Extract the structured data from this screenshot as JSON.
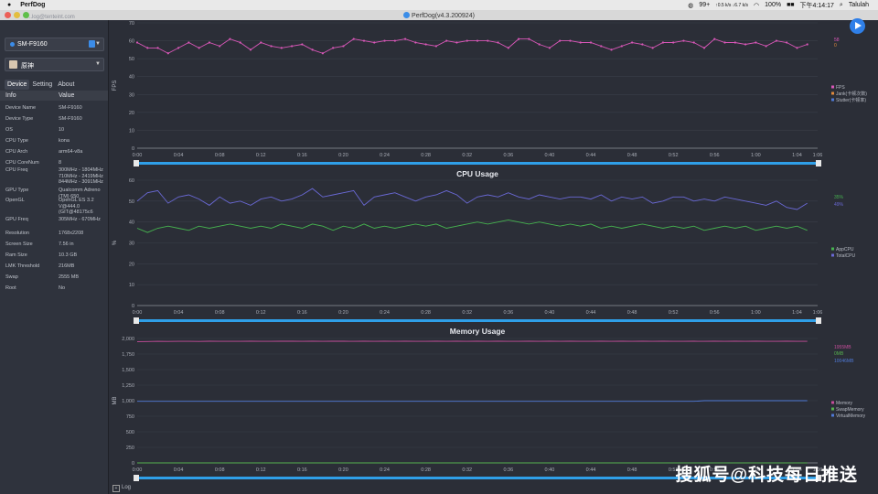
{
  "menubar": {
    "app": "PerfDog",
    "status_notifications": "99+",
    "net_speed": "↑0.5 k/s ↓6.7 k/s",
    "battery": "100%",
    "battery_badge": "■■",
    "clock": "下午4:14:17",
    "user": "Talulah"
  },
  "window": {
    "title": "PerfDog(v4.3.200924)"
  },
  "sidebar": {
    "account_hint": "...log@tenteint.com",
    "device": "SM-F9160",
    "app": "原神",
    "tabs": [
      "Device",
      "Setting",
      "About"
    ],
    "table_headers": [
      "Info",
      "Value"
    ],
    "rows": [
      {
        "k": "Device Name",
        "v": "SM-F9160"
      },
      {
        "k": "Device Type",
        "v": "SM-F9160"
      },
      {
        "k": "OS",
        "v": "10"
      },
      {
        "k": "CPU Type",
        "v": "kona"
      },
      {
        "k": "CPU Arch",
        "v": "arm64-v8a"
      },
      {
        "k": "CPU CoreNum",
        "v": "8"
      },
      {
        "k": "CPU Freq",
        "v": "300MHz - 1804MHz\n710MHz - 2419MHz\n844MHz - 3091MHz"
      },
      {
        "k": "GPU Type",
        "v": "Qualcomm Adreno\n(TM) 650"
      },
      {
        "k": "OpenGL",
        "v": "OpenGL ES 3.2\nV@444.0\n(GIT@48175c6"
      },
      {
        "k": "GPU Freq",
        "v": "305MHz - 670MHz"
      },
      {
        "k": "Resolution",
        "v": "1768x2208"
      },
      {
        "k": "Screen Size",
        "v": "7.56 in"
      },
      {
        "k": "Ram Size",
        "v": "10.3 GB"
      },
      {
        "k": "LMK Threshold",
        "v": "216MB"
      },
      {
        "k": "Swap",
        "v": "2555 MB"
      },
      {
        "k": "Root",
        "v": "No"
      }
    ]
  },
  "log_label": "Log",
  "watermark": "搜狐号@科技每日推送",
  "colors": {
    "fps": "#d957b8",
    "app_cpu": "#46b34f",
    "total_cpu": "#6a69d6",
    "memory": "#c64d9b",
    "swap": "#56b24f",
    "virtual": "#4f79d6",
    "range_bar": "#2f9fe8"
  },
  "chart_data": [
    {
      "type": "line",
      "title": "FPS",
      "ylabel": "FPS",
      "ylim": [
        0,
        70
      ],
      "yticks": [
        "0",
        "10",
        "20",
        "30",
        "40",
        "50",
        "60",
        "70"
      ],
      "xticks": [
        "0:00",
        "0:04",
        "0:08",
        "0:12",
        "0:16",
        "0:20",
        "0:24",
        "0:28",
        "0:32",
        "0:36",
        "0:40",
        "0:44",
        "0:48",
        "0:52",
        "0:56",
        "1:00",
        "1:04",
        "1:06"
      ],
      "series": [
        {
          "name": "FPS",
          "values": [
            59,
            56,
            56,
            53,
            56,
            59,
            56,
            59,
            57,
            61,
            59,
            55,
            59,
            57,
            56,
            57,
            58,
            55,
            53,
            56,
            57,
            61,
            60,
            59,
            60,
            60,
            61,
            59,
            58,
            57,
            60,
            59,
            60,
            60,
            60,
            59,
            56,
            61,
            61,
            58,
            56,
            60,
            60,
            59,
            59,
            57,
            55,
            57,
            59,
            58,
            56,
            59,
            59,
            60,
            59,
            56,
            61,
            59,
            59,
            58,
            59,
            57,
            60,
            59,
            56,
            58
          ]
        },
        {
          "name": "Jank(卡顿次数)",
          "values": []
        },
        {
          "name": "Stutter(卡顿率)",
          "values": []
        }
      ],
      "current": [
        "58",
        "0"
      ]
    },
    {
      "type": "line",
      "title": "CPU Usage",
      "ylabel": "%",
      "ylim": [
        0,
        60
      ],
      "yticks": [
        "0",
        "10",
        "20",
        "30",
        "40",
        "50",
        "60"
      ],
      "xticks": [
        "0:00",
        "0:04",
        "0:08",
        "0:12",
        "0:16",
        "0:20",
        "0:24",
        "0:28",
        "0:32",
        "0:36",
        "0:40",
        "0:44",
        "0:48",
        "0:52",
        "0:56",
        "1:00",
        "1:04",
        "1:06"
      ],
      "series": [
        {
          "name": "AppCPU",
          "values": [
            37,
            35,
            37,
            38,
            37,
            36,
            38,
            37,
            38,
            39,
            38,
            37,
            38,
            37,
            39,
            38,
            37,
            39,
            38,
            36,
            38,
            37,
            39,
            37,
            38,
            37,
            38,
            39,
            38,
            39,
            37,
            38,
            39,
            40,
            39,
            40,
            41,
            40,
            39,
            40,
            39,
            38,
            39,
            38,
            39,
            37,
            38,
            37,
            38,
            39,
            38,
            37,
            38,
            37,
            38,
            36,
            37,
            38,
            37,
            38,
            36,
            37,
            38,
            37,
            38,
            36
          ]
        },
        {
          "name": "TotalCPU",
          "values": [
            50,
            54,
            55,
            49,
            52,
            53,
            51,
            48,
            52,
            49,
            50,
            48,
            51,
            52,
            50,
            51,
            53,
            56,
            52,
            53,
            54,
            55,
            48,
            52,
            53,
            54,
            52,
            50,
            52,
            53,
            55,
            53,
            49,
            52,
            53,
            52,
            54,
            52,
            51,
            53,
            52,
            51,
            52,
            52,
            51,
            53,
            50,
            52,
            51,
            52,
            49,
            50,
            52,
            52,
            50,
            51,
            50,
            52,
            51,
            50,
            49,
            48,
            50,
            47,
            46,
            49
          ]
        }
      ],
      "current": [
        "35%",
        "49%"
      ]
    },
    {
      "type": "line",
      "title": "Memory Usage",
      "ylabel": "MB",
      "ylim": [
        0,
        2000
      ],
      "yticks": [
        "0",
        "250",
        "500",
        "750",
        "1,000",
        "1,250",
        "1,500",
        "1,750",
        "2,000"
      ],
      "xticks": [
        "0:00",
        "0:04",
        "0:08",
        "0:12",
        "0:16",
        "0:20",
        "0:24",
        "0:28",
        "0:32",
        "0:36",
        "0:40",
        "0:44",
        "0:48",
        "0:52",
        "0:56",
        "1:00",
        "1:04",
        "1:06"
      ],
      "series": [
        {
          "name": "Memory",
          "values": [
            1950,
            1952,
            1955,
            1953,
            1954,
            1955,
            1953,
            1956,
            1955,
            1955,
            1954,
            1956,
            1955,
            1954,
            1956,
            1957,
            1955,
            1956,
            1955,
            1956,
            1956,
            1955,
            1956,
            1955,
            1956,
            1955,
            1956,
            1955,
            1955,
            1956,
            1955,
            1956,
            1955,
            1956,
            1955,
            1956,
            1955,
            1955,
            1956,
            1955,
            1956,
            1955,
            1956,
            1955,
            1955,
            1956,
            1955,
            1956,
            1955,
            1956,
            1955,
            1956,
            1955,
            1955,
            1956,
            1955,
            1956,
            1955,
            1956,
            1955,
            1956,
            1955,
            1955,
            1956,
            1955,
            1955
          ]
        },
        {
          "name": "SwapMemory",
          "values": [
            0,
            0,
            0,
            0,
            0,
            0,
            0,
            0,
            0,
            0,
            0,
            0,
            0,
            0,
            0,
            0,
            0,
            0,
            0,
            0,
            0,
            0,
            0,
            0,
            0,
            0,
            0,
            0,
            0,
            0,
            0,
            0,
            0,
            0,
            0,
            0,
            0,
            0,
            0,
            0,
            0,
            0,
            0,
            0,
            0,
            0,
            0,
            0,
            0,
            0,
            0,
            0,
            0,
            0,
            0,
            0,
            0,
            0,
            0,
            0,
            0,
            0,
            0,
            0,
            0,
            0
          ]
        },
        {
          "name": "VirtualMemory",
          "values": [
            990,
            990,
            990,
            990,
            990,
            990,
            990,
            990,
            990,
            990,
            990,
            990,
            990,
            990,
            990,
            990,
            990,
            990,
            990,
            990,
            990,
            990,
            990,
            990,
            990,
            990,
            990,
            990,
            990,
            990,
            990,
            990,
            990,
            990,
            990,
            990,
            990,
            990,
            990,
            990,
            990,
            990,
            990,
            990,
            990,
            990,
            990,
            990,
            990,
            990,
            990,
            990,
            990,
            990,
            990,
            1000,
            1000,
            1000,
            1000,
            1000,
            1000,
            1000,
            1000,
            1000,
            1000,
            1000
          ]
        }
      ],
      "current": [
        "1955MB",
        "0MB",
        "10046MB"
      ]
    }
  ]
}
